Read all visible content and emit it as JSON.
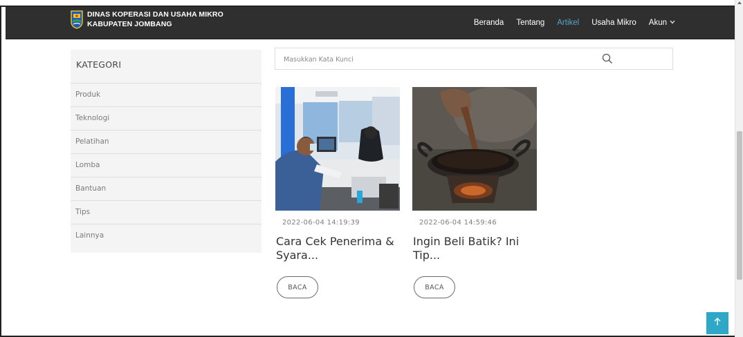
{
  "brand": {
    "line1": "DINAS KOPERASI DAN USAHA MIKRO",
    "line2": "KABUPATEN JOMBANG",
    "logo_icon": "jombang-crest-icon"
  },
  "nav": {
    "items": [
      {
        "label": "Beranda",
        "active": false
      },
      {
        "label": "Tentang",
        "active": false
      },
      {
        "label": "Artikel",
        "active": true
      },
      {
        "label": "Usaha Mikro",
        "active": false
      },
      {
        "label": "Akun",
        "active": false
      }
    ],
    "active_color": "#5aa3c8"
  },
  "sidebar": {
    "title": "KATEGORI",
    "items": [
      {
        "label": "Produk"
      },
      {
        "label": "Teknologi"
      },
      {
        "label": "Pelatihan"
      },
      {
        "label": "Lomba"
      },
      {
        "label": "Bantuan"
      },
      {
        "label": "Tips"
      },
      {
        "label": "Lainnya"
      }
    ]
  },
  "search": {
    "placeholder": "Masukkan Kata Kunci",
    "value": "",
    "icon": "search-icon"
  },
  "articles": [
    {
      "date": "2022-06-04 14:19:39",
      "title": "Cara Cek Penerima & Syara...",
      "button_label": "BACA",
      "image_subject": "office-service-desk-photo"
    },
    {
      "date": "2022-06-04 14:59:46",
      "title": "Ingin Beli Batik? Ini Tip...",
      "button_label": "BACA",
      "image_subject": "batik-wax-pan-photo"
    }
  ],
  "back_to_top": {
    "icon": "arrow-up-icon",
    "color": "#2fa8c8"
  }
}
